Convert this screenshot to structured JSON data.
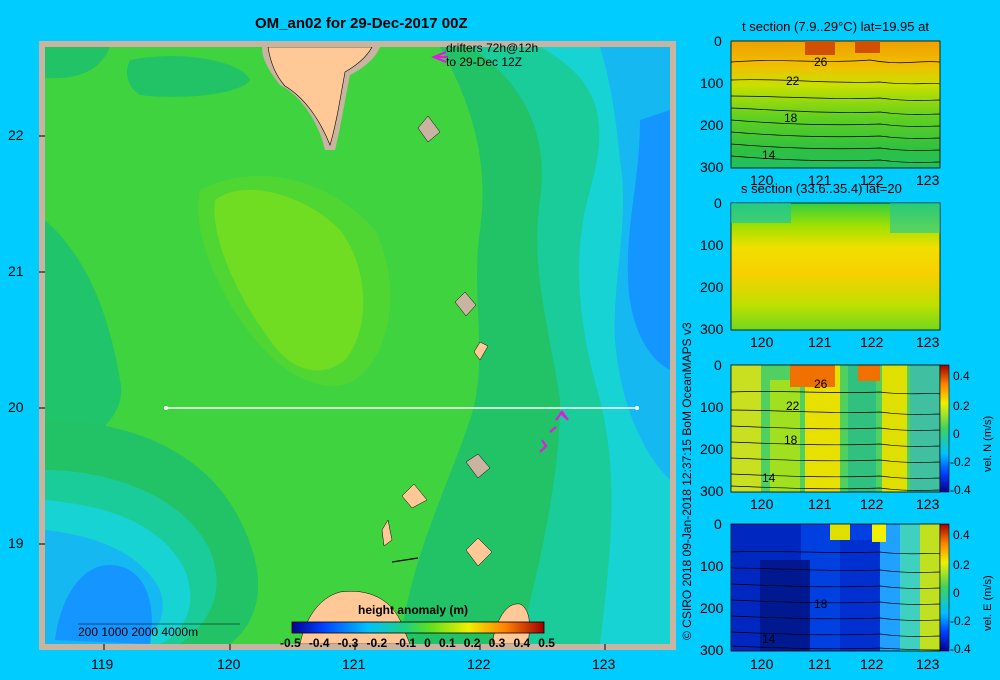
{
  "map": {
    "title": "OM_an02 for 29-Dec-2017 00Z",
    "drifter_label_1": "drifters 72h@12h",
    "drifter_label_2": "to 29-Dec 12Z",
    "lon_ticks": [
      "119",
      "120",
      "121",
      "122",
      "123"
    ],
    "lat_ticks": [
      "22",
      "21",
      "20",
      "19"
    ],
    "depth_legend": "200  1000  2000  4000m",
    "colorbar_title": "height anomaly (m)",
    "colorbar_labels": [
      "-0.5",
      "-0.4",
      "-0.3",
      "-0.2",
      "-0.1",
      "0",
      "0.1",
      "0.2",
      "0.3",
      "0.4",
      "0.5"
    ]
  },
  "credit": "© CSIRO 2018   09-Jan-2018 12:37:15 BoM OceanMAPS v3",
  "panels": [
    {
      "title": "t section (7.9..29°C) lat=19.95 at",
      "y_ticks": [
        "0",
        "100",
        "200",
        "300"
      ],
      "x_ticks": [
        "120",
        "121",
        "122",
        "123"
      ],
      "contour_labels": [
        "26",
        "22",
        "18",
        "14"
      ]
    },
    {
      "title": "s section (33.6..35.4) lat=20",
      "y_ticks": [
        "0",
        "100",
        "200",
        "300"
      ],
      "x_ticks": [
        "120",
        "121",
        "122",
        "123"
      ]
    },
    {
      "y_ticks": [
        "0",
        "100",
        "200",
        "300"
      ],
      "x_ticks": [
        "120",
        "121",
        "122",
        "123"
      ],
      "contour_labels": [
        "26",
        "22",
        "18",
        "14"
      ],
      "colorbar_labels": [
        "0.4",
        "0.2",
        "0",
        "-0.2",
        "-0.4"
      ],
      "colorbar_title": "vel. N (m/s)"
    },
    {
      "y_ticks": [
        "0",
        "100",
        "200",
        "300"
      ],
      "x_ticks": [
        "120",
        "121",
        "122",
        "123"
      ],
      "contour_labels": [
        "18",
        "14"
      ],
      "colorbar_labels": [
        "0.4",
        "0.2",
        "0",
        "-0.2",
        "-0.4"
      ],
      "colorbar_title": "vel. E (m/s)"
    }
  ],
  "colors": {
    "background": "#00ccff",
    "land": "#ffc896",
    "frame": "#c8b4a0",
    "drifter": "#e01ae0",
    "section_line": "#ffffff"
  }
}
